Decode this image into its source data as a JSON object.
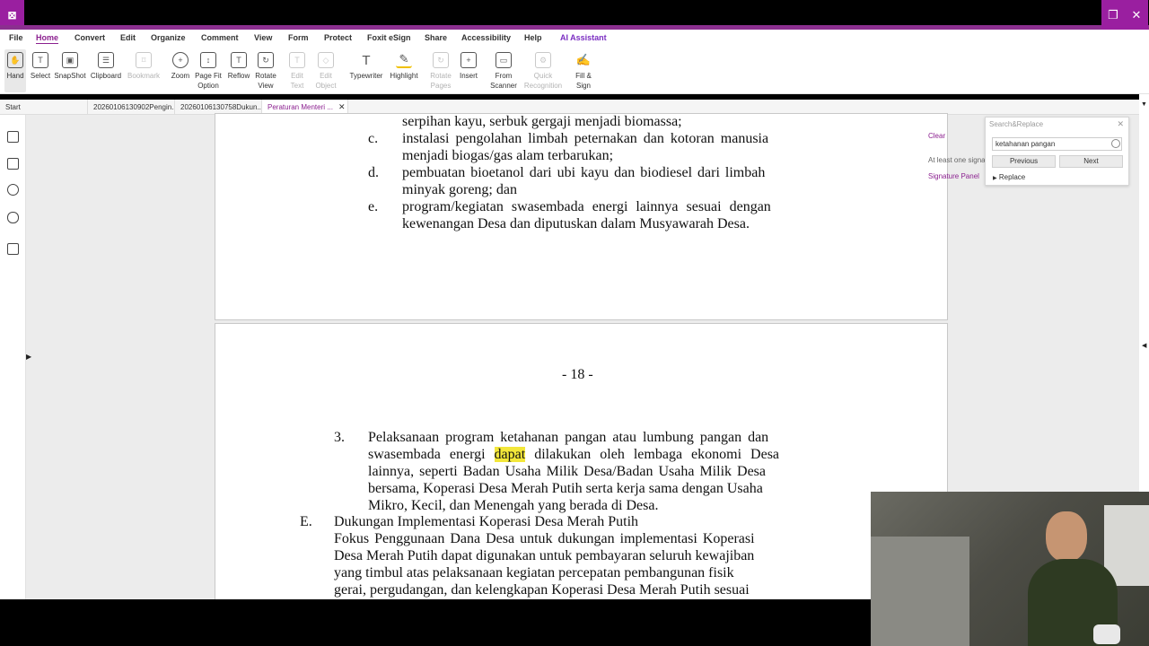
{
  "window": {
    "logo": "⊠",
    "restore": "❐",
    "close": "✕"
  },
  "menu": {
    "items": [
      "File",
      "Home",
      "Convert",
      "Edit",
      "Organize",
      "Comment",
      "View",
      "Form",
      "Protect",
      "Foxit eSign",
      "Share",
      "Accessibility",
      "Help",
      "AI Assistant"
    ],
    "active": "Home"
  },
  "ribbon": {
    "tools": [
      {
        "label": "Hand",
        "icon": "hand-icon"
      },
      {
        "label": "Select",
        "icon": "select-icon"
      },
      {
        "label": "SnapShot",
        "icon": "snapshot-icon"
      },
      {
        "label": "Clipboard",
        "icon": "clipboard-icon"
      },
      {
        "label": "Bookmark",
        "icon": "bookmark-icon"
      },
      {
        "label": "Zoom",
        "icon": "zoom-icon"
      },
      {
        "label": "Page Fit Option",
        "icon": "page-fit-icon"
      },
      {
        "label": "Reflow",
        "icon": "reflow-icon"
      },
      {
        "label": "Rotate View",
        "icon": "rotate-icon"
      },
      {
        "label": "Edit Text",
        "icon": "edit-text-icon"
      },
      {
        "label": "Edit Object",
        "icon": "edit-object-icon"
      },
      {
        "label": "Typewriter",
        "icon": "typewriter-icon"
      },
      {
        "label": "Highlight",
        "icon": "highlight-icon"
      },
      {
        "label": "Rotate Pages",
        "icon": "rotate-pages-icon"
      },
      {
        "label": "Insert",
        "icon": "insert-icon"
      },
      {
        "label": "From Scanner",
        "icon": "scanner-icon"
      },
      {
        "label": "Quick Recognition",
        "icon": "recognition-icon"
      },
      {
        "label": "Fill & Sign",
        "icon": "fill-sign-icon"
      }
    ]
  },
  "tabs": [
    {
      "label": "Start"
    },
    {
      "label": "20260106130902Pengin..."
    },
    {
      "label": "20260106130758Dukun..."
    },
    {
      "label": "Peraturan Menteri ..."
    }
  ],
  "document": {
    "page_top_lines": [
      "serpihan kayu, serbuk gergaji menjadi biomassa;",
      "c.",
      "instalasi pengolahan limbah peternakan dan kotoran manusia",
      "menjadi biogas/gas alam terbarukan;",
      "d.",
      "pembuatan bioetanol dari ubi kayu dan biodiesel dari limbah",
      "minyak goreng; dan",
      "e.",
      "program/kegiatan swasembada energi lainnya sesuai dengan",
      "kewenangan Desa dan diputuskan dalam Musyawarah Desa."
    ],
    "page_number": "- 18 -",
    "item3_num": "3.",
    "item3_l1": "Pelaksanaan program ketahanan pangan atau lumbung pangan dan",
    "item3_l2a": "swasembada energi",
    "item3_l2_hl": "dapat",
    "item3_l2b": "dilakukan oleh lembaga ekonomi Desa",
    "item3_l3": "lainnya, seperti Badan Usaha Milik Desa/Badan Usaha Milik Desa",
    "item3_l4": "bersama, Koperasi Desa Merah Putih serta kerja sama dengan Usaha",
    "item3_l5": "Mikro, Kecil, dan Menengah yang berada di Desa.",
    "sectionE_num": "E.",
    "sectionE_title": "Dukungan Implementasi Koperasi Desa Merah Putih",
    "sectionE_l1": "Fokus Penggunaan Dana Desa untuk dukungan implementasi Koperasi",
    "sectionE_l2": "Desa Merah Putih dapat digunakan untuk pembayaran seluruh kewajiban",
    "sectionE_l3": "yang timbul atas pelaksanaan kegiatan percepatan pembangunan fisik",
    "sectionE_l4": "gerai, pergudangan, dan kelengkapan Koperasi Desa Merah Putih sesuai"
  },
  "search": {
    "title": "Search&Replace",
    "query": "ketahanan pangan",
    "previous": "Previous",
    "next": "Next",
    "replace": "Replace"
  },
  "signature": {
    "clear": "Clear",
    "note": "At least one signat",
    "link": "Signature Panel"
  }
}
